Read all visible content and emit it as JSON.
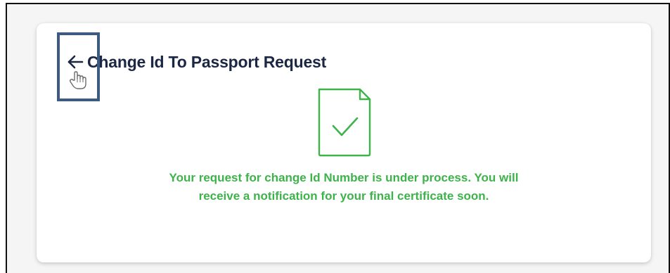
{
  "header": {
    "back_icon": "arrow-left-icon",
    "title": "Change Id To Passport Request"
  },
  "status": {
    "icon": "document-check-icon",
    "message": "Your request for change Id Number is under process. You will receive a notification for your final certificate soon.",
    "color": "#3db34a"
  },
  "cursor_icon": "hand-pointer-icon",
  "highlight_color": "#3d5a80"
}
